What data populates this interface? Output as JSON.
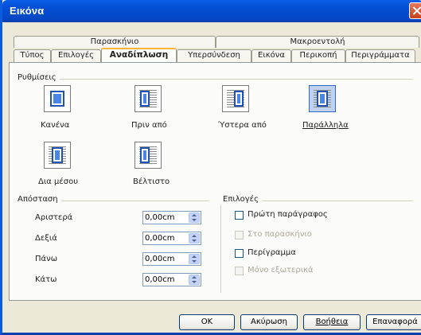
{
  "window": {
    "title": "Εικόνα"
  },
  "tabs_row1": [
    {
      "label": "Παρασκήνιο"
    },
    {
      "label": "Μακροεντολή"
    }
  ],
  "tabs_row2": [
    {
      "label": "Τύπος"
    },
    {
      "label": "Επιλογές"
    },
    {
      "label": "Αναδίπλωση",
      "active": true
    },
    {
      "label": "Υπερσύνδεση"
    },
    {
      "label": "Εικόνα"
    },
    {
      "label": "Περικοπή"
    },
    {
      "label": "Περιγράμματα"
    }
  ],
  "settings": {
    "label": "Ρυθμίσεις",
    "options": [
      {
        "label": "Κανένα",
        "icon": "wrap-none-icon"
      },
      {
        "label": "Πριν από",
        "icon": "wrap-before-icon"
      },
      {
        "label": "Ύστερα από",
        "icon": "wrap-after-icon"
      },
      {
        "label": "Παράλληλα",
        "icon": "wrap-parallel-icon",
        "selected": true
      },
      {
        "label": "Δια μέσου",
        "icon": "wrap-through-icon"
      },
      {
        "label": "Βέλτιστο",
        "icon": "wrap-optimal-icon"
      }
    ]
  },
  "spacing": {
    "label": "Απόσταση",
    "fields": [
      {
        "label": "Αριστερά",
        "value": "0,00cm"
      },
      {
        "label": "Δεξιά",
        "value": "0,00cm"
      },
      {
        "label": "Πάνω",
        "value": "0,00cm"
      },
      {
        "label": "Κάτω",
        "value": "0,00cm"
      }
    ]
  },
  "options": {
    "label": "Επιλογές",
    "items": [
      {
        "label": "Πρώτη παράγραφος",
        "enabled": true,
        "checked": false
      },
      {
        "label": "Στο παρασκήνιο",
        "enabled": false,
        "checked": false
      },
      {
        "label": "Περίγραμμα",
        "enabled": true,
        "checked": false
      },
      {
        "label": "Μόνο εξωτερικά",
        "enabled": false,
        "checked": false
      }
    ]
  },
  "buttons": {
    "ok": "OK",
    "cancel": "Ακύρωση",
    "help": "Βοήθεια",
    "reset": "Επαναφορά"
  },
  "colors": {
    "titlebar": "#0550d8",
    "dialog_bg": "#ece9d8",
    "active_tab_accent": "#ffb637",
    "selected_icon_bg": "#c1d2ee"
  }
}
